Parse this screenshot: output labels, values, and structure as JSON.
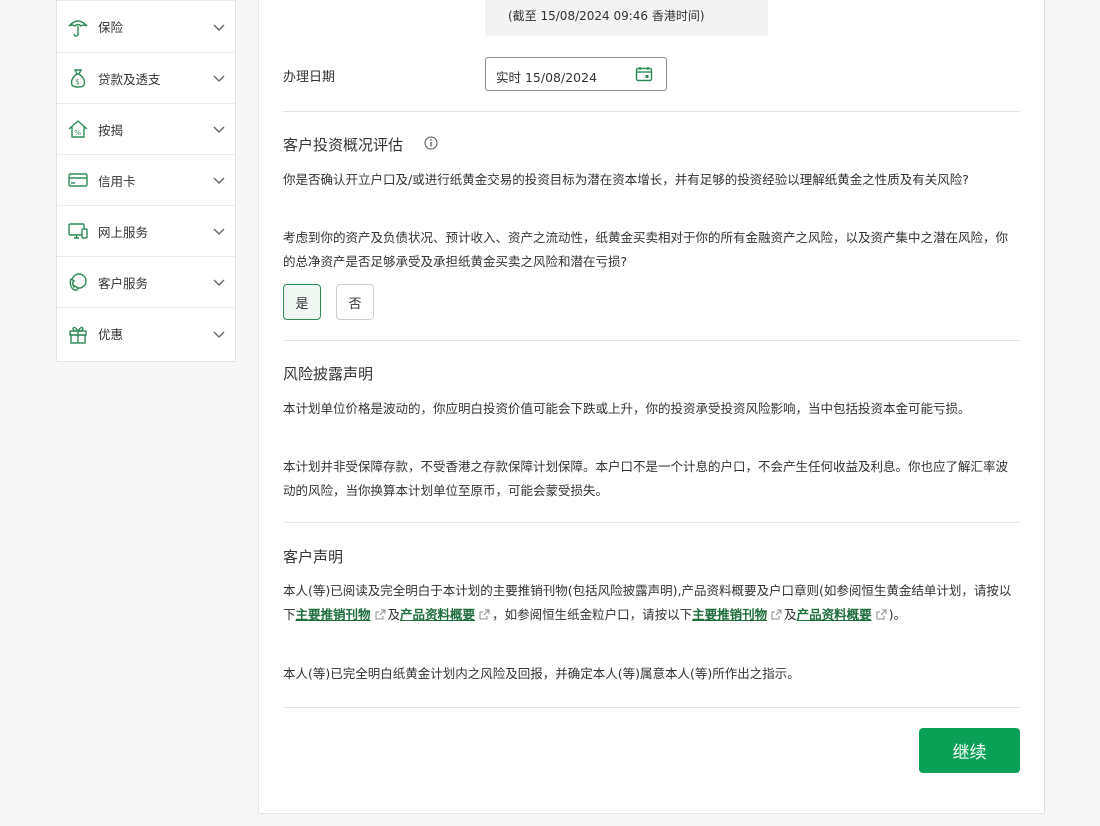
{
  "sidebar": {
    "items": [
      {
        "label": "保险",
        "icon": "umbrella-icon"
      },
      {
        "label": "贷款及透支",
        "icon": "money-bag-icon"
      },
      {
        "label": "按揭",
        "icon": "house-percent-icon"
      },
      {
        "label": "信用卡",
        "icon": "credit-card-icon"
      },
      {
        "label": "网上服务",
        "icon": "computer-icon"
      },
      {
        "label": "客户服务",
        "icon": "phone-service-icon"
      },
      {
        "label": "优惠",
        "icon": "gift-icon"
      }
    ]
  },
  "rate_note": "(截至 15/08/2024 09:46 香港时间)",
  "transaction_date": {
    "label": "办理日期",
    "value": "实时 15/08/2024"
  },
  "assessment": {
    "title": "客户投资概况评估",
    "q1": "你是否确认开立户口及/或进行纸黄金交易的投资目标为潜在资本增长，并有足够的投资经验以理解纸黄金之性质及有关风险?",
    "q2": "考虑到你的资产及负债状况、预计收入、资产之流动性，纸黄金买卖相对于你的所有金融资产之风险，以及资产集中之潜在风险，你的总净资产是否足够承受及承担纸黄金买卖之风险和潜在亏损?",
    "yes_label": "是",
    "no_label": "否"
  },
  "risk": {
    "title": "风险披露声明",
    "p1": "本计划单位价格是波动的，你应明白投资价值可能会下跌或上升，你的投资承受投资风险影响，当中包括投资本金可能亏损。",
    "p2": "本计划并非受保障存款，不受香港之存款保障计划保障。本户口不是一个计息的户口，不会产生任何收益及利息。你也应了解汇率波动的风险，当你换算本计划单位至原币，可能会蒙受损失。"
  },
  "declaration": {
    "title": "客户声明",
    "p1_a": "本人(等)已阅读及完全明白于本计划的主要推销刊物(包括风险披露声明),产品资料概要及户口章则(如参阅恒生黄金结单计划，请按以下",
    "link1": "主要推销刊物",
    "p1_b": "及",
    "link2": "产品资料概要",
    "p1_c": "，如参阅恒生纸金粒户口，请按以下",
    "link3": "主要推销刊物",
    "p1_d": "及",
    "link4": "产品资料概要",
    "p1_e": ")。",
    "p2": "本人(等)已完全明白纸黄金计划内之风险及回报，并确定本人(等)属意本人(等)所作出之指示。"
  },
  "continue_label": "继续",
  "colors": {
    "accent": "#0aa058",
    "link": "#1e6e3e",
    "icon_green": "#2e8b57"
  }
}
